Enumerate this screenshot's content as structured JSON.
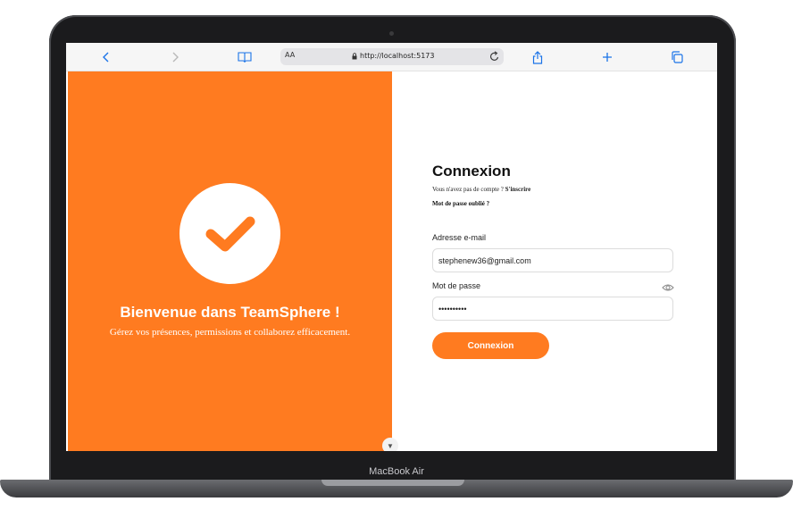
{
  "device": {
    "brand": "MacBook Air"
  },
  "browser": {
    "text_size_label": "AA",
    "url": "http://localhost:5173",
    "icons": [
      "back-icon",
      "forward-icon",
      "bookmarks-icon",
      "lock-icon",
      "reload-icon",
      "share-icon",
      "new-tab-icon",
      "tabs-icon"
    ]
  },
  "left_panel": {
    "title": "Bienvenue dans TeamSphere !",
    "tagline": "Gérez vos présences, permissions et collaborez efficacement.",
    "icon": "checkmark-icon",
    "color": "#ff7b20"
  },
  "form": {
    "title": "Connexion",
    "no_account_text": "Vous n'avez pas de compte ?",
    "signup_link": "S'inscrire",
    "forgot_link": "Mot de passe oublié ?",
    "email_label": "Adresse e-mail",
    "email_value": "stephenew36@gmail.com",
    "password_label": "Mot de passe",
    "password_value": "••••••••••",
    "submit_label": "Connexion",
    "accent": "#ff7b20"
  }
}
